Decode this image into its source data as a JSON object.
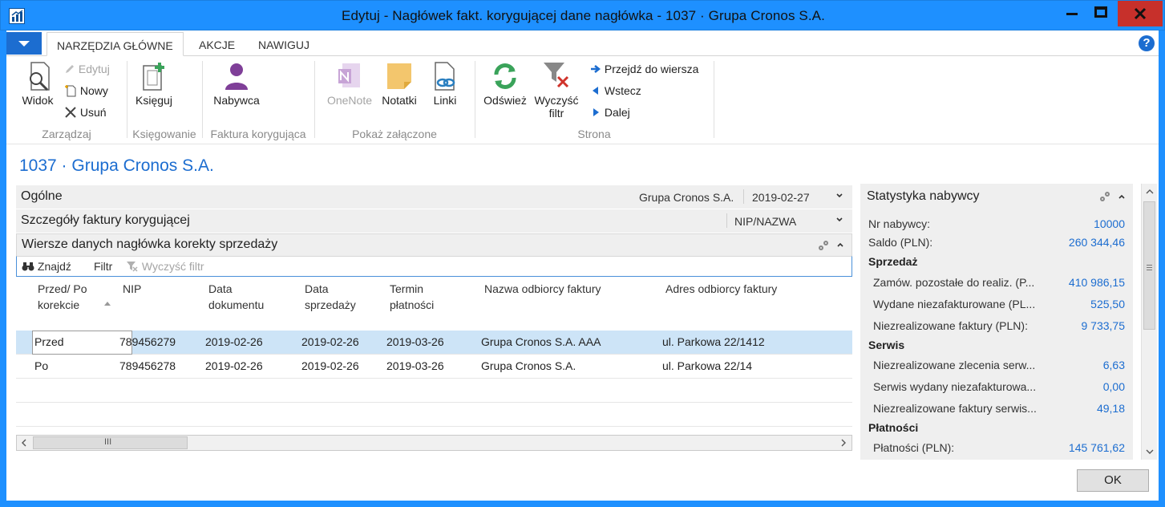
{
  "window": {
    "title": "Edytuj - Nagłówek fakt. korygującej dane nagłówka - 1037 · Grupa Cronos S.A."
  },
  "tabs": [
    "NARZĘDZIA GŁÓWNE",
    "AKCJE",
    "NAWIGUJ"
  ],
  "ribbon": {
    "widok": "Widok",
    "edytuj": "Edytuj",
    "nowy": "Nowy",
    "usun": "Usuń",
    "ksieguj": "Księguj",
    "nabywca": "Nabywca",
    "onenote": "OneNote",
    "notatki": "Notatki",
    "linki": "Linki",
    "odswiez": "Odśwież",
    "wyczysc_filtr_1": "Wyczyść",
    "wyczysc_filtr_2": "filtr",
    "przejdz": "Przejdź do wiersza",
    "wstecz": "Wstecz",
    "dalej": "Dalej",
    "groups": {
      "zarzadzaj": "Zarządzaj",
      "ksiegowanie": "Księgowanie",
      "faktura": "Faktura korygująca",
      "pokaz": "Pokaż załączone",
      "strona": "Strona"
    }
  },
  "page_title": "1037 · Grupa Cronos S.A.",
  "fasttabs": {
    "ogolne": {
      "title": "Ogólne",
      "val1": "Grupa Cronos S.A.",
      "val2": "2019-02-27"
    },
    "szczegoly": {
      "title": "Szczegóły faktury korygującej",
      "val1": "NIP/NAZWA"
    }
  },
  "lines": {
    "title": "Wiersze danych nagłówka korekty sprzedaży",
    "toolbar": {
      "znajdz": "Znajdź",
      "filtr": "Filtr",
      "wyczysc": "Wyczyść filtr"
    },
    "headers": {
      "przed_po_1": "Przed/ Po",
      "przed_po_2": "korekcie",
      "nip": "NIP",
      "data_dok_1": "Data",
      "data_dok_2": "dokumentu",
      "data_sprz_1": "Data",
      "data_sprz_2": "sprzedaży",
      "termin_1": "Termin",
      "termin_2": "płatności",
      "nazwa": "Nazwa odbiorcy faktury",
      "adres": "Adres odbiorcy faktury"
    },
    "rows": [
      {
        "przed_po": "Przed",
        "nip": "789456279",
        "data_dok": "2019-02-26",
        "data_sprz": "2019-02-26",
        "termin": "2019-03-26",
        "nazwa": "Grupa Cronos S.A. AAA",
        "adres": "ul. Parkowa 22/1412"
      },
      {
        "przed_po": "Po",
        "nip": "789456278",
        "data_dok": "2019-02-26",
        "data_sprz": "2019-02-26",
        "termin": "2019-03-26",
        "nazwa": "Grupa Cronos S.A.",
        "adres": "ul. Parkowa 22/14"
      }
    ],
    "scroll_thumb": "III"
  },
  "factbox": {
    "title": "Statystyka nabywcy",
    "nr_label": "Nr nabywcy:",
    "nr_val": "10000",
    "saldo_label": "Saldo (PLN):",
    "saldo_val": "260 344,46",
    "sprzedaz": "Sprzedaż",
    "zamow_label": "Zamów. pozostałe do realiz. (P...",
    "zamow_val": "410 986,15",
    "wydane_label": "Wydane niezafakturowane (PL...",
    "wydane_val": "525,50",
    "niezreal_label": "Niezrealizowane faktury (PLN):",
    "niezreal_val": "9 733,75",
    "serwis": "Serwis",
    "zlecenia_label": "Niezrealizowane zlecenia serw...",
    "zlecenia_val": "6,63",
    "serwis_wyd_label": "Serwis wydany niezafakturowa...",
    "serwis_wyd_val": "0,00",
    "faktury_serw_label": "Niezrealizowane faktury serwis...",
    "faktury_serw_val": "49,18",
    "platnosci": "Płatności",
    "platnosci_label": "Płatności (PLN):",
    "platnosci_val": "145 761,62"
  },
  "ok_label": "OK"
}
